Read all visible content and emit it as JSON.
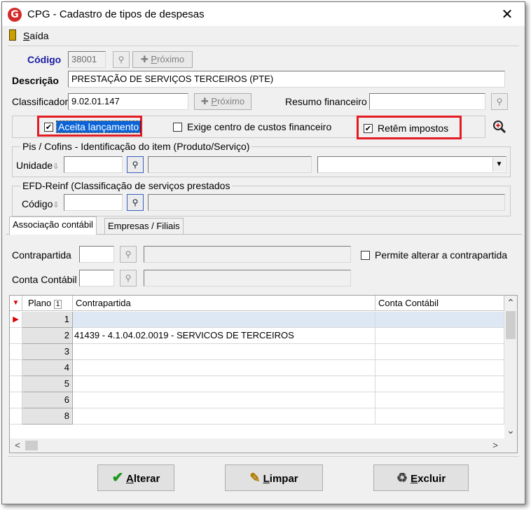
{
  "window": {
    "title": "CPG - Cadastro de tipos de despesas",
    "app_icon_glyph": "G",
    "close_glyph": "✕"
  },
  "menu": {
    "exit_label_initial": "S",
    "exit_label_rest": "aída"
  },
  "codigo": {
    "label": "Código",
    "value": "38001",
    "next_button_prefix": "✚ ",
    "next_button_initial": "P",
    "next_button_rest": "róximo"
  },
  "descricao": {
    "label": "Descrição",
    "value": "PRESTAÇÃO DE SERVIÇOS TERCEIROS (PTE)"
  },
  "classificador": {
    "label": "Classificador",
    "value": "9.02.01.147",
    "next_button_prefix": "✚ ",
    "next_button_initial": "P",
    "next_button_rest": "róximo"
  },
  "resumo_financeiro": {
    "label": "Resumo financeiro",
    "value": ""
  },
  "flags": {
    "aceita_lancamento": {
      "label": "Aceita lançamento",
      "checked": true,
      "mark": "✔"
    },
    "exige_centro_custos": {
      "label": "Exige centro de custos financeiro",
      "checked": false,
      "mark": ""
    },
    "retem_impostos": {
      "label": "Retêm impostos",
      "checked": true,
      "mark": "✔"
    }
  },
  "pis_cofins": {
    "group_title": "Pis / Cofins - Identificação do item (Produto/Serviço)",
    "unidade_label": "Unidade",
    "sort_glyph": "⇩",
    "unidade_value": "",
    "desc_value": "",
    "select_value": ""
  },
  "efd_reinf": {
    "group_title": "EFD-Reinf (Classificação de serviços prestados",
    "codigo_label": "Código",
    "sort_glyph": "⇩",
    "codigo_value": "",
    "desc_value": ""
  },
  "tabs": [
    {
      "label": "Associação contábil",
      "active": true
    },
    {
      "label": "Empresas / Filiais",
      "active": false
    }
  ],
  "contrapartida": {
    "label": "Contrapartida",
    "value": "",
    "desc": "",
    "permite_alterar_label": "Permite alterar a contrapartida",
    "permite_alterar_checked": false
  },
  "conta_contabil": {
    "label": "Conta Contábil",
    "value": "",
    "desc": ""
  },
  "grid": {
    "columns": [
      "Plano",
      "Contrapartida",
      "Conta Contábil"
    ],
    "sort_badge": "1",
    "current_row_marker": "▶",
    "filter_marker": "▼",
    "rows": [
      {
        "plano": "1",
        "contrapartida": "",
        "conta_contabil": "",
        "selected": true
      },
      {
        "plano": "2",
        "contrapartida": "41439 - 4.1.04.02.0019 - SERVICOS DE TERCEIROS",
        "conta_contabil": ""
      },
      {
        "plano": "3",
        "contrapartida": "",
        "conta_contabil": ""
      },
      {
        "plano": "4",
        "contrapartida": "",
        "conta_contabil": ""
      },
      {
        "plano": "5",
        "contrapartida": "",
        "conta_contabil": ""
      },
      {
        "plano": "6",
        "contrapartida": "",
        "conta_contabil": ""
      },
      {
        "plano": "8",
        "contrapartida": "",
        "conta_contabil": ""
      }
    ],
    "scroll_up": "⌃",
    "scroll_down": "⌄",
    "scroll_left": "<",
    "scroll_right": ">"
  },
  "buttons": {
    "alterar": {
      "initial": "A",
      "rest": "lterar",
      "icon": "✔"
    },
    "limpar": {
      "initial": "L",
      "rest": "impar",
      "icon": "✎"
    },
    "excluir": {
      "initial": "E",
      "rest": "xcluir",
      "icon": "♻"
    }
  },
  "colors": {
    "accent_red": "#e31c24",
    "label_blue": "#1a1aa6",
    "selected_row": "#dde8f4",
    "check_green": "#1a9a1a"
  }
}
